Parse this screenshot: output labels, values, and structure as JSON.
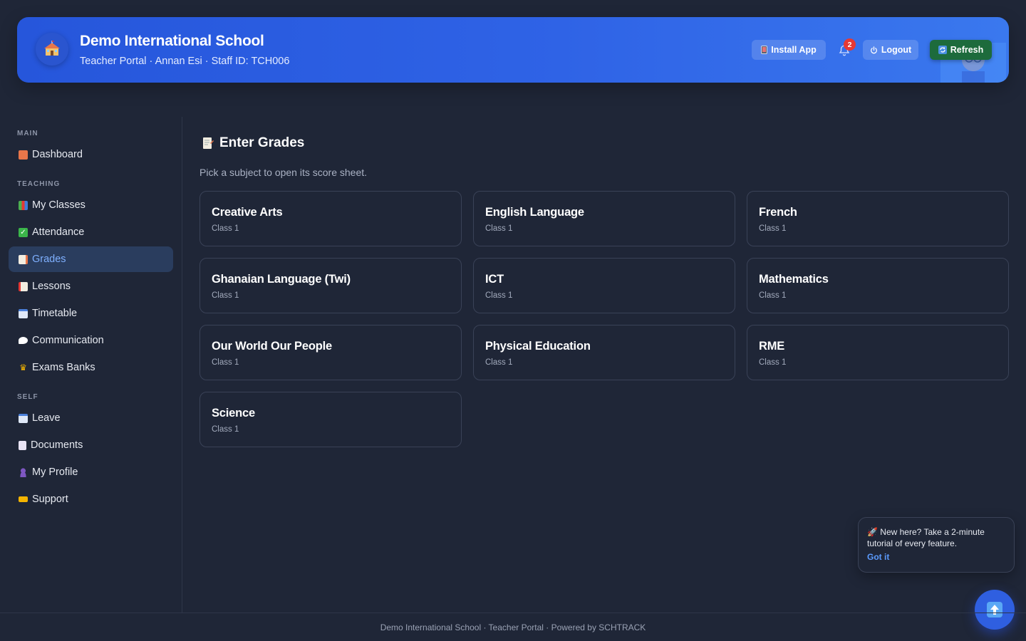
{
  "header": {
    "school_name": "Demo International School",
    "subtitle": "Teacher Portal · Annan Esi · Staff ID: TCH006",
    "install_label": "Install App",
    "notification_count": "2",
    "logout_label": "Logout",
    "refresh_label": "Refresh"
  },
  "sidebar": {
    "sections": {
      "main": "MAIN",
      "teaching": "TEACHING",
      "self": "SELF"
    },
    "items": [
      {
        "label": "Dashboard",
        "icon": "house-icon"
      },
      {
        "label": "My Classes",
        "icon": "books-icon"
      },
      {
        "label": "Attendance",
        "icon": "checkbox-icon"
      },
      {
        "label": "Grades",
        "icon": "memo-icon",
        "active": true
      },
      {
        "label": "Lessons",
        "icon": "notebook-icon"
      },
      {
        "label": "Timetable",
        "icon": "calendar-icon"
      },
      {
        "label": "Communication",
        "icon": "speech-bubble-icon"
      },
      {
        "label": "Exams Banks",
        "icon": "crown-icon"
      },
      {
        "label": "Leave",
        "icon": "calendar-icon"
      },
      {
        "label": "Documents",
        "icon": "document-icon"
      },
      {
        "label": "My Profile",
        "icon": "person-icon"
      },
      {
        "label": "Support",
        "icon": "ticket-icon"
      }
    ]
  },
  "main": {
    "title": "Enter Grades",
    "subtitle": "Pick a subject to open its score sheet.",
    "subjects": [
      {
        "name": "Creative Arts",
        "class": "Class 1"
      },
      {
        "name": "English Language",
        "class": "Class 1"
      },
      {
        "name": "French",
        "class": "Class 1"
      },
      {
        "name": "Ghanaian Language (Twi)",
        "class": "Class 1"
      },
      {
        "name": "ICT",
        "class": "Class 1"
      },
      {
        "name": "Mathematics",
        "class": "Class 1"
      },
      {
        "name": "Our World Our People",
        "class": "Class 1"
      },
      {
        "name": "Physical Education",
        "class": "Class 1"
      },
      {
        "name": "RME",
        "class": "Class 1"
      },
      {
        "name": "Science",
        "class": "Class 1"
      }
    ]
  },
  "tour": {
    "message": "New here? Take a 2-minute tutorial of every feature.",
    "button": "Got it"
  },
  "footer": {
    "text": "Demo International School · Teacher Portal · Powered by SCHTRACK"
  },
  "colors": {
    "accent": "#2f63e6",
    "background": "#1f2637",
    "active_nav": "#2a3d5e",
    "refresh": "#1d6b3c",
    "badge": "#e53935"
  }
}
